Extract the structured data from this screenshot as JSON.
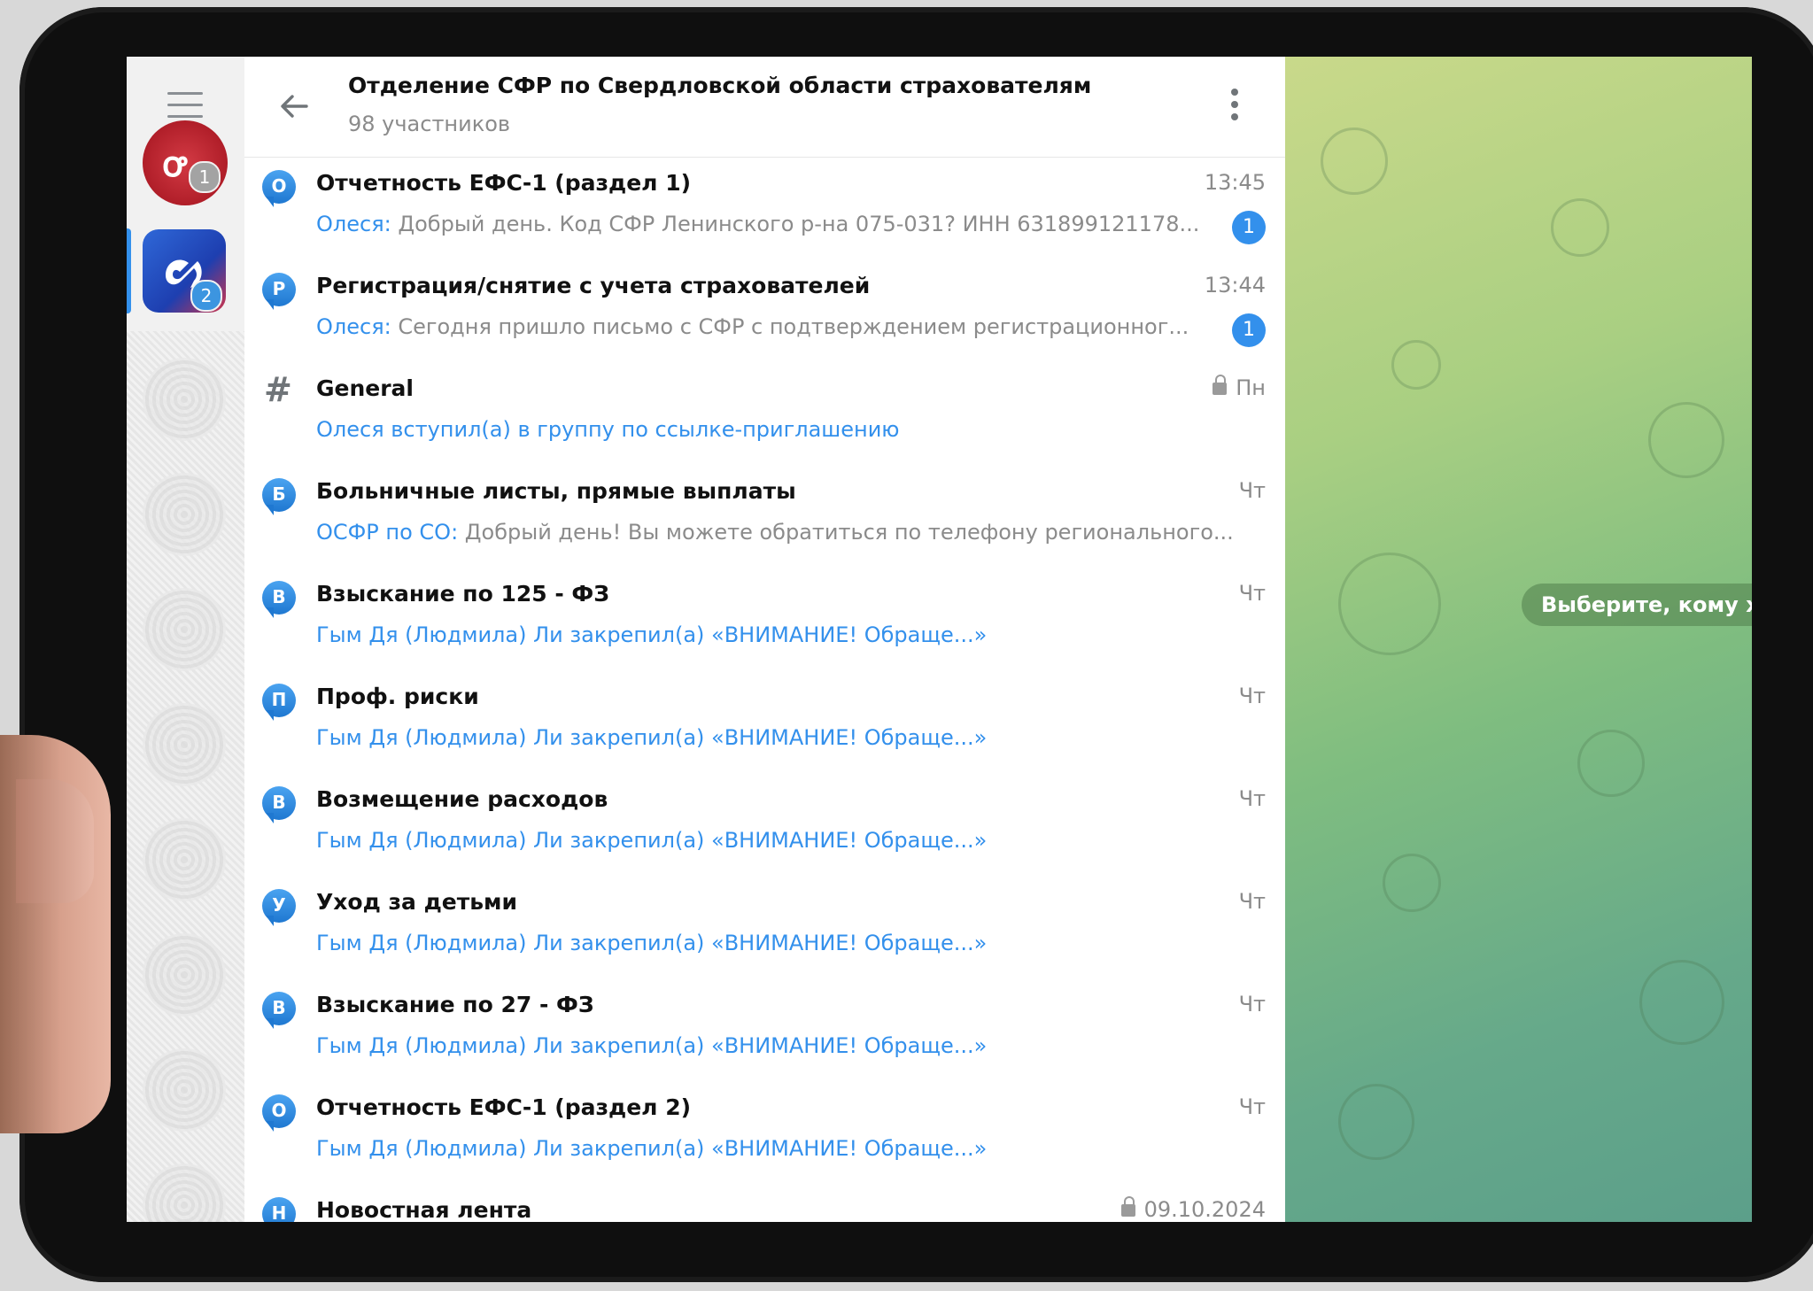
{
  "header": {
    "title": "Отделение СФР по Свердловской области страхователям",
    "subtitle": "98 участников"
  },
  "rail": {
    "badges": [
      "1",
      "2"
    ]
  },
  "topics": [
    {
      "icon_letter": "О",
      "title": "Отчетность ЕФС-1 (раздел 1)",
      "time": "13:45",
      "sender": "Олеся:",
      "text": " Добрый день. Код СФР Ленинского р-на 075-031? ИНН 631899121178...",
      "unread": "1",
      "locked": false
    },
    {
      "icon_letter": "Р",
      "title": "Регистрация/снятие с учета страхователей",
      "time": "13:44",
      "sender": "Олеся:",
      "text": " Сегодня пришло письмо с СФР с подтверждением регистрационног...",
      "unread": "1",
      "locked": false
    },
    {
      "icon_letter": "#",
      "title": "General",
      "time": "Пн",
      "sender": "",
      "service": "Олеся вступил(а) в группу по ссылке-приглашению",
      "text": "",
      "unread": "",
      "locked": true
    },
    {
      "icon_letter": "Б",
      "title": "Больничные листы, прямые выплаты",
      "time": "Чт",
      "sender": "ОСФР по СО:",
      "text": " Добрый день! Вы можете обратиться по телефону регионального...",
      "unread": "",
      "locked": false
    },
    {
      "icon_letter": "В",
      "title": "Взыскание по 125 - ФЗ",
      "time": "Чт",
      "sender": "",
      "service": "Гым Дя (Людмила) Ли закрепил(а) «ВНИМАНИЕ! Обраще...»",
      "text": "",
      "unread": "",
      "locked": false
    },
    {
      "icon_letter": "П",
      "title": "Проф. риски",
      "time": "Чт",
      "sender": "",
      "service": "Гым Дя (Людмила) Ли закрепил(а) «ВНИМАНИЕ! Обраще...»",
      "text": "",
      "unread": "",
      "locked": false
    },
    {
      "icon_letter": "В",
      "title": "Возмещение расходов",
      "time": "Чт",
      "sender": "",
      "service": "Гым Дя (Людмила) Ли закрепил(а) «ВНИМАНИЕ! Обраще...»",
      "text": "",
      "unread": "",
      "locked": false
    },
    {
      "icon_letter": "У",
      "title": "Уход за детьми",
      "time": "Чт",
      "sender": "",
      "service": "Гым Дя (Людмила) Ли закрепил(а) «ВНИМАНИЕ! Обраще...»",
      "text": "",
      "unread": "",
      "locked": false
    },
    {
      "icon_letter": "В",
      "title": "Взыскание по 27 - ФЗ",
      "time": "Чт",
      "sender": "",
      "service": "Гым Дя (Людмила) Ли закрепил(а) «ВНИМАНИЕ! Обраще...»",
      "text": "",
      "unread": "",
      "locked": false
    },
    {
      "icon_letter": "О",
      "title": "Отчетность ЕФС-1 (раздел 2)",
      "time": "Чт",
      "sender": "",
      "service": "Гым Дя (Людмила) Ли закрепил(а) «ВНИМАНИЕ! Обраще...»",
      "text": "",
      "unread": "",
      "locked": false
    },
    {
      "icon_letter": "Н",
      "title": "Новостная лента",
      "time": "09.10.2024",
      "sender": "",
      "service": "",
      "text": "",
      "unread": "",
      "locked": true
    }
  ],
  "wallpaper": {
    "hint": "Выберите, кому х"
  },
  "colors": {
    "accent": "#3390ec",
    "muted": "#8b8b8b"
  }
}
